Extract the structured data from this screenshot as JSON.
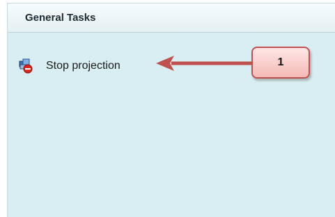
{
  "panel": {
    "title": "General Tasks",
    "tasks": [
      {
        "label": "Stop projection",
        "icon": "stop-projection-icon"
      }
    ]
  },
  "annotation": {
    "callout_number": "1",
    "color": "#c0504d"
  }
}
